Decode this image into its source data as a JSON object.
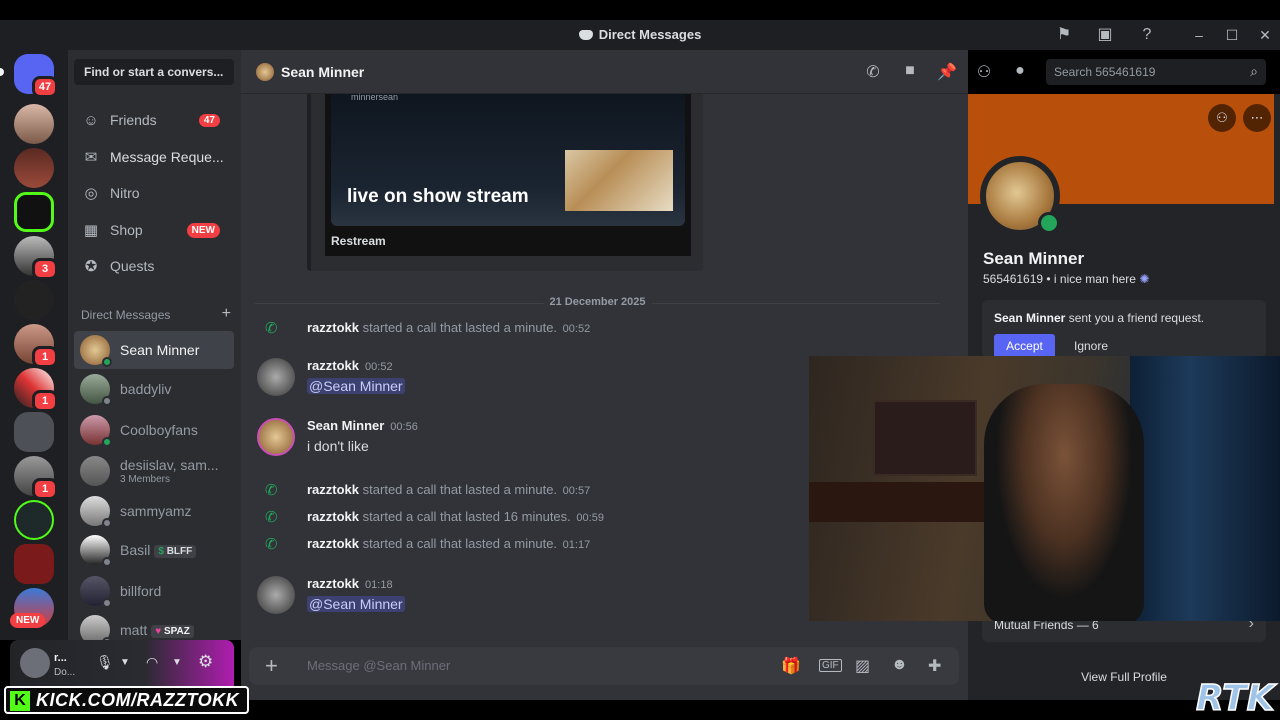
{
  "window": {
    "title": "Direct Messages"
  },
  "guilds": {
    "home_badge": "47",
    "items": [
      {
        "badge": ""
      },
      {
        "badge": ""
      },
      {
        "badge": ""
      },
      {
        "badge": "3"
      },
      {
        "badge": ""
      },
      {
        "badge": "1"
      },
      {
        "badge": "1"
      },
      {
        "badge": ""
      },
      {
        "badge": "1"
      },
      {
        "badge": ""
      },
      {
        "badge": ""
      }
    ],
    "new_label": "NEW"
  },
  "dm_sidebar": {
    "search_placeholder": "Find or start a convers...",
    "nav": [
      {
        "label": "Friends",
        "count": "47"
      },
      {
        "label": "Message Reque..."
      },
      {
        "label": "Nitro"
      },
      {
        "label": "Shop",
        "badge": "NEW"
      },
      {
        "label": "Quests"
      }
    ],
    "section_title": "Direct Messages",
    "dms": [
      {
        "name": "Sean Minner",
        "active": true
      },
      {
        "name": "baddyliv"
      },
      {
        "name": "Coolboyfans"
      },
      {
        "name": "desiislav, sam...",
        "sub": "3 Members"
      },
      {
        "name": "sammyamz"
      },
      {
        "name": "Basil",
        "tag": "BLFF"
      },
      {
        "name": "billford"
      },
      {
        "name": "matt",
        "tag": "SPAZ"
      }
    ]
  },
  "user_panel": {
    "name": "r...",
    "status": "Do..."
  },
  "chat": {
    "recipient": "Sean Minner",
    "search_placeholder": "Search 565461619",
    "embed": {
      "mini_label": "minnersean",
      "headline": "live on show stream",
      "provider": "Restream"
    },
    "date_divider": "21 December 2025",
    "call_1": {
      "who": "razztokk",
      "text": "started a call that lasted a minute.",
      "time": "00:52"
    },
    "msg_1": {
      "author": "razztokk",
      "time": "00:52",
      "body": "@Sean Minner"
    },
    "msg_2": {
      "author": "Sean Minner",
      "time": "00:56",
      "body": "i don't like"
    },
    "call_2": {
      "who": "razztokk",
      "text": "started a call that lasted a minute.",
      "time": "00:57"
    },
    "call_3": {
      "who": "razztokk",
      "text": "started a call that lasted 16 minutes.",
      "time": "00:59"
    },
    "call_4": {
      "who": "razztokk",
      "text": "started a call that lasted a minute.",
      "time": "01:17"
    },
    "msg_3": {
      "author": "razztokk",
      "time": "01:18",
      "body": "@Sean Minner"
    },
    "composer_placeholder": "Message @Sean Minner"
  },
  "profile": {
    "display_name": "Sean Minner",
    "username_line": "565461619 • i nice man here",
    "friend_request_name": "Sean Minner",
    "friend_request_text": " sent you a friend request.",
    "accept_label": "Accept",
    "ignore_label": "Ignore",
    "mutual_friends": "Mutual Friends — 6",
    "view_full": "View Full Profile",
    "banner_color": "#b8500b"
  },
  "overlay": {
    "url": "KICK.COM/RAZZTOKK",
    "logo_text": "RTK"
  },
  "colors": {
    "accent": "#5865f2",
    "online": "#23a55a",
    "badge": "#f23f43",
    "kick_green": "#53fc18"
  }
}
